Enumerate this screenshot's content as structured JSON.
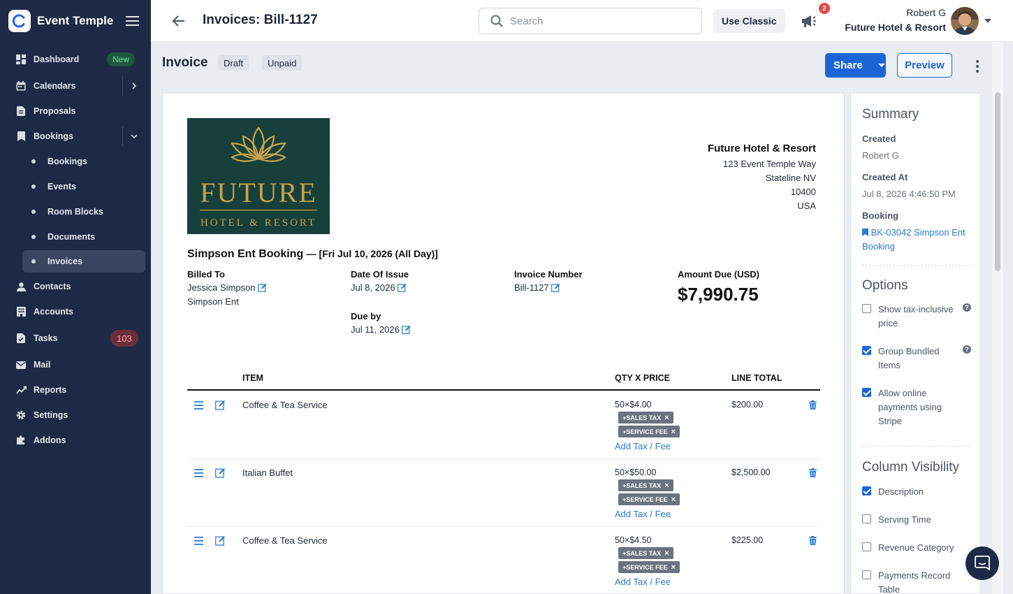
{
  "brand": {
    "name": "Event Temple"
  },
  "sidebar": {
    "items": [
      {
        "label": "Dashboard",
        "badge": "New"
      },
      {
        "label": "Calendars"
      },
      {
        "label": "Proposals"
      },
      {
        "label": "Bookings"
      },
      {
        "label": "Bookings"
      },
      {
        "label": "Events"
      },
      {
        "label": "Room Blocks"
      },
      {
        "label": "Documents"
      },
      {
        "label": "Invoices"
      },
      {
        "label": "Contacts"
      },
      {
        "label": "Accounts"
      },
      {
        "label": "Tasks",
        "badge": "103"
      },
      {
        "label": "Mail"
      },
      {
        "label": "Reports"
      },
      {
        "label": "Settings"
      },
      {
        "label": "Addons"
      }
    ]
  },
  "header": {
    "title": "Invoices: Bill-1127",
    "search_placeholder": "Search",
    "use_classic": "Use Classic",
    "notification_count": "2",
    "user_name": "Robert G",
    "user_org": "Future Hotel & Resort"
  },
  "invoice_header": {
    "title": "Invoice",
    "statuses": [
      "Draft",
      "Unpaid"
    ],
    "share_label": "Share",
    "preview_label": "Preview"
  },
  "invoice": {
    "logo": {
      "line1": "FUTURE",
      "line2": "HOTEL & RESORT"
    },
    "hotel": {
      "name": "Future Hotel & Resort",
      "address": [
        "123 Event Temple Way",
        "Stateline NV",
        "10400",
        "USA"
      ]
    },
    "booking_title": "Simpson Ent Booking",
    "booking_date": "— [Fri Jul 10, 2026 (All Day)]",
    "billed_to": {
      "label": "Billed To",
      "name": "Jessica Simpson",
      "company": "Simpson Ent"
    },
    "date_of_issue": {
      "label": "Date Of Issue",
      "value": "Jul 8, 2026"
    },
    "due_by": {
      "label": "Due by",
      "value": "Jul 11, 2026"
    },
    "invoice_number": {
      "label": "Invoice Number",
      "value": "Bill-1127"
    },
    "amount_due": {
      "label": "Amount Due (USD)",
      "value": "$7,990.75"
    },
    "columns": [
      "ITEM",
      "QTY X PRICE",
      "LINE TOTAL"
    ],
    "tags": [
      "+SALES TAX",
      "+SERVICE FEE"
    ],
    "add_tax_label": "Add Tax / Fee",
    "lines": [
      {
        "item": "Coffee & Tea Service",
        "qty_price": "50×$4.00",
        "total": "$200.00"
      },
      {
        "item": "Italian Buffet",
        "qty_price": "50×$50.00",
        "total": "$2,500.00"
      },
      {
        "item": "Coffee & Tea Service",
        "qty_price": "50×$4.50",
        "total": "$225.00"
      }
    ]
  },
  "summary": {
    "title": "Summary",
    "created_label": "Created",
    "created_value": "Robert G",
    "created_at_label": "Created At",
    "created_at_value": "Jul 8, 2026 4:46:50 PM",
    "booking_label": "Booking",
    "booking_link": "BK-03042 Simpson Ent Booking",
    "options_title": "Options",
    "options": [
      {
        "label": "Show tax-inclusive price",
        "checked": false
      },
      {
        "label": "Group Bundled Items",
        "checked": true
      },
      {
        "label": "Allow online payments using Stripe",
        "checked": true
      }
    ],
    "column_visibility_title": "Column Visibility",
    "columns": [
      {
        "label": "Description",
        "checked": true
      },
      {
        "label": "Serving Time",
        "checked": false
      },
      {
        "label": "Revenue Category",
        "checked": false
      },
      {
        "label": "Payments Record Table",
        "checked": false
      }
    ]
  },
  "colors": {
    "sidebar_bg": "#1e2a45",
    "primary": "#1a64d6",
    "link": "#2b7bd0",
    "logo_bg": "#17403a",
    "logo_gold": "#c9a24a"
  }
}
